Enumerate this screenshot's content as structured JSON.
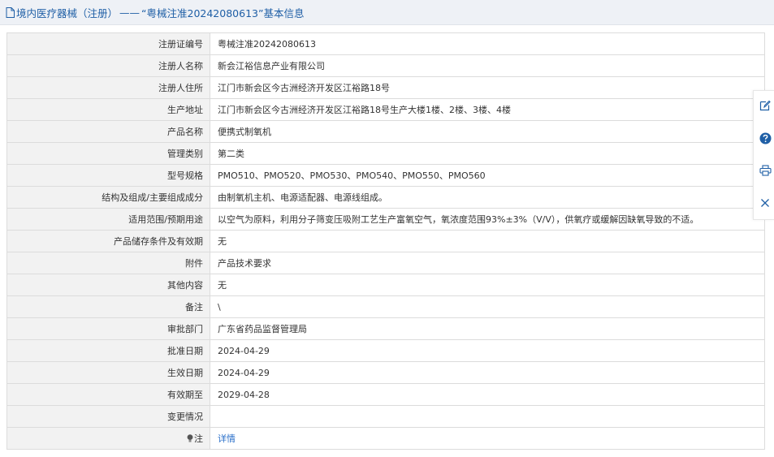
{
  "header": {
    "category": "境内医疗器械（注册）",
    "separator": "——",
    "title": "“粤械注准20242080613”基本信息"
  },
  "rows": [
    {
      "label": "注册证编号",
      "value": "粤械注准20242080613"
    },
    {
      "label": "注册人名称",
      "value": "新会江裕信息产业有限公司"
    },
    {
      "label": "注册人住所",
      "value": "江门市新会区今古洲经济开发区江裕路18号"
    },
    {
      "label": "生产地址",
      "value": "江门市新会区今古洲经济开发区江裕路18号生产大楼1楼、2楼、3楼、4楼"
    },
    {
      "label": "产品名称",
      "value": "便携式制氧机"
    },
    {
      "label": "管理类别",
      "value": "第二类"
    },
    {
      "label": "型号规格",
      "value": "PMO510、PMO520、PMO530、PMO540、PMO550、PMO560"
    },
    {
      "label": "结构及组成/主要组成成分",
      "value": "由制氧机主机、电源适配器、电源线组成。"
    },
    {
      "label": "适用范围/预期用途",
      "value": "以空气为原料，利用分子筛变压吸附工艺生产富氧空气，氧浓度范围93%±3%（V/V），供氧疗或缓解因缺氧导致的不适。"
    },
    {
      "label": "产品储存条件及有效期",
      "value": "无"
    },
    {
      "label": "附件",
      "value": "产品技术要求"
    },
    {
      "label": "其他内容",
      "value": "无"
    },
    {
      "label": "备注",
      "value": "\\"
    },
    {
      "label": "审批部门",
      "value": "广东省药品监督管理局"
    },
    {
      "label": "批准日期",
      "value": "2024-04-29"
    },
    {
      "label": "生效日期",
      "value": "2024-04-29"
    },
    {
      "label": "有效期至",
      "value": "2029-04-28"
    },
    {
      "label": "变更情况",
      "value": ""
    }
  ],
  "note_row": {
    "label": "注",
    "link": "详情"
  },
  "sidebar": {
    "icons": [
      "edit-icon",
      "help-icon",
      "print-icon",
      "close-icon"
    ],
    "accent": "#1f5fa6"
  }
}
